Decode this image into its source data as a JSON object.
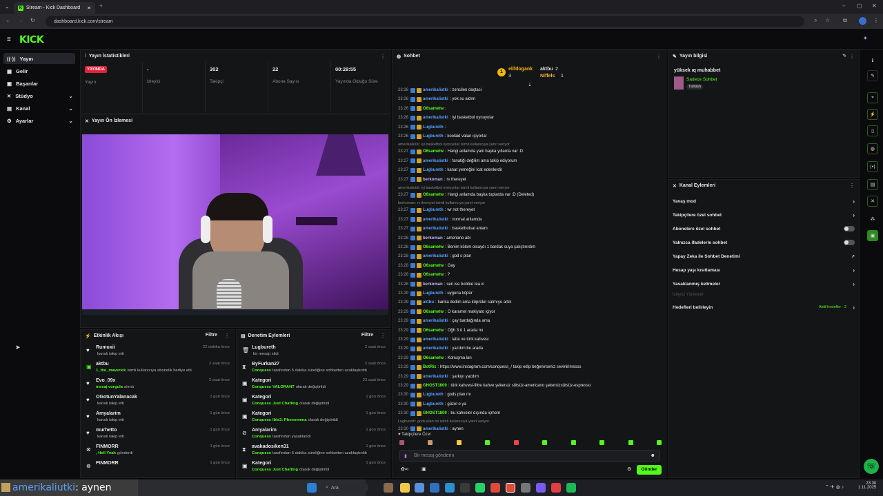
{
  "browser": {
    "tab_title": "Stream - Kick Dashboard",
    "url": "dashboard.kick.com/stream"
  },
  "brand": {
    "logo": "KICK",
    "accent": "#53fc18"
  },
  "sidebar": {
    "items": [
      {
        "label": "Yayın",
        "icon": "broadcast-icon",
        "active": true
      },
      {
        "label": "Gelir",
        "icon": "money-icon"
      },
      {
        "label": "Başarılar",
        "icon": "trophy-icon"
      },
      {
        "label": "Stüdyo",
        "icon": "studio-icon",
        "expandable": true
      },
      {
        "label": "Kanal",
        "icon": "channel-icon",
        "expandable": true
      },
      {
        "label": "Ayarlar",
        "icon": "settings-icon",
        "expandable": true
      }
    ]
  },
  "stats": {
    "title": "Yayın İstatistikleri",
    "live_badge": "YAYINDA",
    "items": [
      {
        "value": "",
        "label": "Yayın"
      },
      {
        "value": "-",
        "label": "İzleyici"
      },
      {
        "value": "302",
        "label": "Takipçi"
      },
      {
        "value": "22",
        "label": "Abone Sayısı"
      },
      {
        "value": "00:28:55",
        "label": "Yayında Olduğu Süre"
      }
    ]
  },
  "preview": {
    "title": "Yayın Ön İzlemesi"
  },
  "activity": {
    "title": "Etkinlik Akışı",
    "filter": "Filtre",
    "rows": [
      {
        "name": "Rumuxii",
        "desc": "kanalı takip etti",
        "highlight": "",
        "time": "22 dakika önce"
      },
      {
        "name": "aktbu",
        "desc": "isimli kullanıcıya abonelik hediye etti.",
        "highlight": "1_the_maverick",
        "time": "2 saat önce"
      },
      {
        "name": "Evo_09x",
        "desc": "alındı",
        "highlight": "mesaj vurgula",
        "time": "2 saat önce"
      },
      {
        "name": "OGotunYalanacak",
        "desc": "kanalı takip etti",
        "highlight": "",
        "time": "1 gün önce"
      },
      {
        "name": "Amyalarim",
        "desc": "kanalı takip etti",
        "highlight": "",
        "time": "1 gün önce"
      },
      {
        "name": "murhetto",
        "desc": "kanalı takip etti",
        "highlight": "",
        "time": "1 gün önce"
      },
      {
        "name": "FINMORR",
        "desc": "gönderdi",
        "highlight": ", Hell Yeah",
        "extra": "1",
        "time": "1 gün önce"
      },
      {
        "name": "FINMORR",
        "desc": "",
        "highlight": "",
        "time": "1 gün önce"
      }
    ]
  },
  "moderation": {
    "title": "Denetim Eylemleri",
    "filter": "Filtre",
    "rows": [
      {
        "name": "Lugbureth",
        "desc": "bir mesajı sildi",
        "highlight": "",
        "time": "2 saat önce"
      },
      {
        "name": "ByFurkan27",
        "desc": "tarafından 5 dakika süreliğine sohbetten uzaklaştırıldı",
        "highlight": "Conquess",
        "time": "2 saat önce"
      },
      {
        "name": "Kategori",
        "desc": "olarak değiştirildi",
        "highlight": "Conquess",
        "cat": "VALORANT",
        "time": "23 saat önce"
      },
      {
        "name": "Kategori",
        "desc": "olarak değiştirildi",
        "highlight": "Conquess",
        "cat": "Just Chatting",
        "time": "1 gün önce"
      },
      {
        "name": "Kategori",
        "desc": "olarak değiştirildi",
        "highlight": "Conquess",
        "cat": "Ibis3: Phenomena",
        "time": "1 gün önce"
      },
      {
        "name": "Amyalarim",
        "desc": "tarafından yasaklandı",
        "highlight": "Conquess",
        "time": "1 gün önce"
      },
      {
        "name": "avakadosiken31",
        "desc": "tarafından 5 dakika süreliğine sohbetten uzaklaştırıldı",
        "highlight": "Conquess",
        "time": "1 gün önce"
      },
      {
        "name": "Kategori",
        "desc": "olarak değiştirildi",
        "highlight": "Conquess",
        "cat": "Just Chatting",
        "time": "1 gün önce"
      }
    ]
  },
  "chat": {
    "title": "Sohbet",
    "top": [
      {
        "name": "elifdogank",
        "count": "3"
      },
      {
        "name": "aktbu",
        "count": "2"
      },
      {
        "name": "Niffels",
        "count": "1"
      }
    ],
    "lines": [
      {
        "t": "23:26",
        "u": "amerikaliutki",
        "c": "#5aa0ff",
        "m": "zencilen daştaci"
      },
      {
        "t": "23:26",
        "u": "amerikaliutki",
        "c": "#5aa0ff",
        "m": "yok su aldım"
      },
      {
        "t": "23:26",
        "u": "O6sametw",
        "c": "#53fc18",
        "m": ""
      },
      {
        "t": "23:26",
        "u": "amerikaliutki",
        "c": "#5aa0ff",
        "m": "iyi basketbol oynuyolar"
      },
      {
        "t": "23:26",
        "u": "Lugbureth",
        "c": "#5aa0ff",
        "m": ""
      },
      {
        "t": "23:26",
        "u": "Lugbureth",
        "c": "#5aa0ff",
        "m": "koolaid valan içiyorlar"
      },
      {
        "sys": "amerikaliutki: iyi basketbol oynuyolar isimli kullanıcıya yanıt veriyor"
      },
      {
        "t": "23:27",
        "u": "O6sametw",
        "c": "#53fc18",
        "m": "Hangi anlamda yani başka yıllarda var :D"
      },
      {
        "t": "23:27",
        "u": "amerikaliutki",
        "c": "#5aa0ff",
        "m": "fanatiği değilim ama takip ediyorum"
      },
      {
        "t": "23:27",
        "u": "Lugbureth",
        "c": "#5aa0ff",
        "m": "kanat yemeğini icat edenlerdir"
      },
      {
        "t": "23:27",
        "u": "berkoman",
        "c": "#c2b1ff",
        "m": "rv thereyet"
      },
      {
        "sys": "amerikaliutki: iyi basketbol oynuyolar isimli kullanıcıya yanıt veriyor"
      },
      {
        "t": "23:27",
        "u": "O6sametw",
        "c": "#53fc18",
        "m": "Hangi anlamda başka toplarda var :D (Deleted)"
      },
      {
        "sys": "berkoman: rv thereyet isimli kullanıcıya yanıt veriyor"
      },
      {
        "t": "23:27",
        "u": "Lugbureth",
        "c": "#5aa0ff",
        "m": "wr not thereyet"
      },
      {
        "t": "23:27",
        "u": "amerikaliutki",
        "c": "#5aa0ff",
        "m": "normal anlamda"
      },
      {
        "t": "23:27",
        "u": "amerikaliutki",
        "c": "#5aa0ff",
        "m": "basketbolsal anlam"
      },
      {
        "t": "23:28",
        "u": "berkoman",
        "c": "#c2b1ff",
        "m": "ameriano abi"
      },
      {
        "t": "23:28",
        "u": "O6sametw",
        "c": "#53fc18",
        "m": "Benim kölem oisaydı 1 bardak suya çalıştırırdım"
      },
      {
        "t": "23:28",
        "u": "amerikaliutki",
        "c": "#5aa0ff",
        "m": "god s plan"
      },
      {
        "t": "23:28",
        "u": "O6sametw",
        "c": "#53fc18",
        "m": "Gay"
      },
      {
        "t": "23:28",
        "u": "O6sametw",
        "c": "#53fc18",
        "m": "?"
      },
      {
        "t": "23:28",
        "u": "berkoman",
        "c": "#c2b1ff",
        "m": "sen ise bobbie tea ic"
      },
      {
        "t": "23:29",
        "u": "Lugbureth",
        "c": "#5aa0ff",
        "m": "uyguna köpür"
      },
      {
        "t": "23:29",
        "u": "aktbu",
        "c": "#5aa0ff",
        "m": "kanka dedim ama köprüler satmıyo artık"
      },
      {
        "t": "23:29",
        "u": "O6sametw",
        "c": "#53fc18",
        "m": "O karamel makiyato içiyor"
      },
      {
        "t": "23:29",
        "u": "amerikaliutki",
        "c": "#5aa0ff",
        "m": "çay bardağında ama"
      },
      {
        "t": "23:29",
        "u": "O6sametw",
        "c": "#53fc18",
        "m": "Oğh 3 ü 1 arada mı"
      },
      {
        "t": "23:29",
        "u": "amerikaliutki",
        "c": "#5aa0ff",
        "m": "latte ve türk kahvesi"
      },
      {
        "t": "23:29",
        "u": "amerikaliutki",
        "c": "#5aa0ff",
        "m": "yazdım bu arada"
      },
      {
        "t": "23:29",
        "u": "O6sametw",
        "c": "#53fc18",
        "m": "Konuşma lan"
      },
      {
        "t": "23:29",
        "u": "BotRix",
        "c": "#53fc18",
        "m": "https://www.instagram.com/conquess_/ takip edip beğenirseniz sevinirimssss"
      },
      {
        "t": "23:29",
        "u": "amerikaliutki",
        "c": "#5aa0ff",
        "m": "şarkıyı yazdım"
      },
      {
        "t": "23:29",
        "u": "GHOST1809",
        "c": "#53fc18",
        "m": "türk kahvesi-filtre kahve şekersiz sütsüz-americano şekersizsütsüz-espresso"
      },
      {
        "t": "23:30",
        "u": "Lugbureth",
        "c": "#5aa0ff",
        "m": "gods plan mı"
      },
      {
        "t": "23:30",
        "u": "Lugbureth",
        "c": "#5aa0ff",
        "m": "güzel o ya"
      },
      {
        "t": "23:30",
        "u": "GHOST1809",
        "c": "#53fc18",
        "m": "bu kahveler dışında içmem"
      },
      {
        "sys": "Lugbureth: gods plan mı isimli kullanıcıya yanıt veriyor"
      },
      {
        "t": "23:30",
        "u": "amerikaliutki",
        "c": "#5aa0ff",
        "m": "aynen"
      }
    ],
    "followers_only": "Takipçilere Özel",
    "input_placeholder": "Bir mesaj gönderin",
    "send": "Gönder"
  },
  "info": {
    "title": "Yayın bilgisi",
    "stream_title": "yüksek ıq muhabbet",
    "category": "Sadece Sohbet",
    "lang": "Türkish"
  },
  "actions": {
    "title": "Kanal Eylemleri",
    "items": [
      {
        "label": "Yavaş mod",
        "type": "arrow"
      },
      {
        "label": "Takipçilere özel sohbet",
        "type": "arrow"
      },
      {
        "label": "Abonelere özel sohbet",
        "type": "toggle"
      },
      {
        "label": "Yalnızca ifadelerle sohbet",
        "type": "toggle"
      },
      {
        "label": "Yapay Zeka ile Sohbet Denetimi",
        "type": "link"
      },
      {
        "label": "Hesap yaşı kısıtlaması",
        "type": "arrow"
      },
      {
        "label": "Yasaklanmış kelimeler",
        "type": "arrow"
      }
    ],
    "section": "İzleyici Yönlendir",
    "goals": "Hedefleri belirleyin",
    "goals_badge": "Aktif hedefler · 2"
  },
  "overlay": {
    "user": "amerikaliutki",
    "message": ": aynen"
  },
  "taskbar": {
    "search": "Ara",
    "time": "23:30",
    "date": "1.11.2025"
  }
}
